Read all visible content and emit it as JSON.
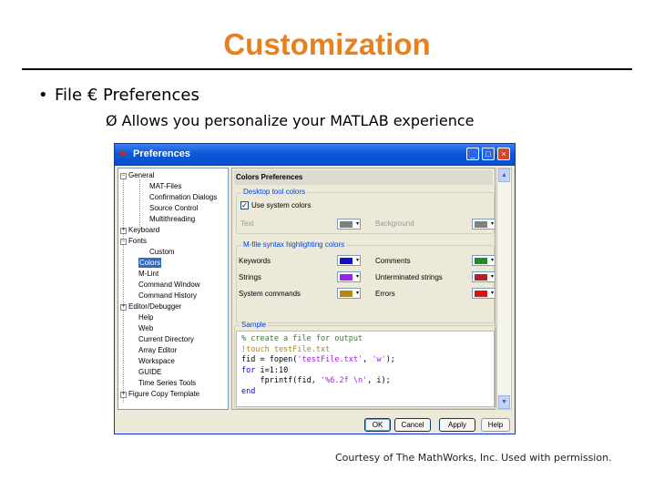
{
  "slide": {
    "title": "Customization",
    "bullet1_marker": "•",
    "bullet1": "File € Preferences",
    "bullet2": "Ø Allows you personalize your MATLAB experience",
    "credit": "Courtesy of The MathWorks, Inc. Used with permission."
  },
  "window": {
    "title": "Preferences",
    "min_label": "_",
    "max_label": "□",
    "close_label": "×",
    "tree": {
      "general": "General",
      "mat_files": "MAT-Files",
      "confirmation_dialogs": "Confirmation Dialogs",
      "source_control": "Source Control",
      "multithreading": "Multithreading",
      "keyboard": "Keyboard",
      "fonts": "Fonts",
      "custom": "Custom",
      "colors": "Colors",
      "mlint": "M-Lint",
      "command_window": "Command Window",
      "command_history": "Command History",
      "editor_debugger": "Editor/Debugger",
      "help": "Help",
      "web": "Web",
      "current_directory": "Current Directory",
      "array_editor": "Array Editor",
      "workspace": "Workspace",
      "guide": "GUIDE",
      "time_series_tools": "Time Series Tools",
      "figure_copy_template": "Figure Copy Template"
    },
    "panel": {
      "heading": "Colors Preferences",
      "desktop_group": "Desktop tool colors",
      "use_system_colors": "Use system colors",
      "text_label": "Text",
      "background_label": "Background",
      "syntax_group": "M-file syntax highlighting colors",
      "keywords_label": "Keywords",
      "comments_label": "Comments",
      "strings_label": "Strings",
      "unterminated_label": "Unterminated strings",
      "system_commands_label": "System commands",
      "errors_label": "Errors",
      "sample_group": "Sample"
    },
    "colors": {
      "keywords": "#1010c8",
      "comments": "#228b22",
      "strings": "#a020f0",
      "unterminated": "#b22222",
      "system_commands": "#b8860b",
      "errors": "#e01010",
      "text": "#808080",
      "background": "#808080"
    },
    "sample": {
      "line1": "% create a file for output",
      "line2": "!touch testFile.txt",
      "line3_a": "fid = fopen(",
      "line3_str": "'testFile.txt'",
      "line3_b": ", ",
      "line3_str2": "'w'",
      "line3_c": ");",
      "line4_kw": "for",
      "line4_rest": " i=1:10",
      "line5_a": "    fprintf(fid, ",
      "line5_str": "'%6.2f \\n'",
      "line5_b": ", i);",
      "line6_kw": "end"
    },
    "buttons": {
      "ok": "OK",
      "cancel": "Cancel",
      "apply": "Apply",
      "help": "Help"
    }
  }
}
